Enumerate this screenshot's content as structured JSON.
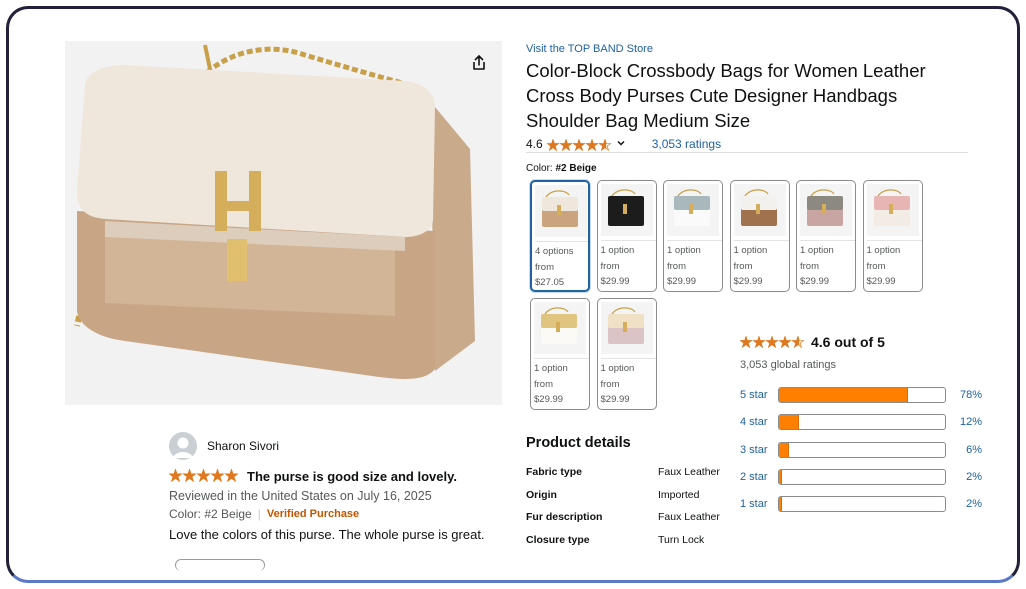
{
  "store": {
    "link_text": "Visit the TOP BAND Store"
  },
  "product": {
    "title": "Color-Block Crossbody Bags for Women Leather Cross Body Purses Cute Designer Handbags Shoulder Bag Medium Size",
    "rating_value": "4.6",
    "rating_stars": 4.6,
    "ratings_link": "3,053 ratings"
  },
  "color": {
    "label": "Color:",
    "selected": "#2 Beige",
    "options": [
      {
        "line1": "4 options",
        "line2": "from",
        "price": "$27.05",
        "top": "#efe7dc",
        "body": "#c9a47e"
      },
      {
        "line1": "1 option",
        "line2": "from",
        "price": "$29.99",
        "top": "#1c1c1c",
        "body": "#1c1c1c"
      },
      {
        "line1": "1 option",
        "line2": "from",
        "price": "$29.99",
        "top": "#a9b8bd",
        "body": "#fafafa"
      },
      {
        "line1": "1 option",
        "line2": "from",
        "price": "$29.99",
        "top": "#f3f1ee",
        "body": "#a0734e"
      },
      {
        "line1": "1 option",
        "line2": "from",
        "price": "$29.99",
        "top": "#8c8a80",
        "body": "#c8a5a2"
      },
      {
        "line1": "1 option",
        "line2": "from",
        "price": "$29.99",
        "top": "#e7b5b3",
        "body": "#f3ece6"
      },
      {
        "line1": "1 option",
        "line2": "from",
        "price": "$29.99",
        "top": "#e0c581",
        "body": "#fbfaf6"
      },
      {
        "line1": "1 option",
        "line2": "from",
        "price": "$29.99",
        "top": "#efe0c6",
        "body": "#dcc3c6"
      }
    ]
  },
  "summary": {
    "out_of": "4.6 out of 5",
    "global": "3,053 global ratings",
    "histogram": [
      {
        "label": "5 star",
        "percent": 78,
        "pct_text": "78%"
      },
      {
        "label": "4 star",
        "percent": 12,
        "pct_text": "12%"
      },
      {
        "label": "3 star",
        "percent": 6,
        "pct_text": "6%"
      },
      {
        "label": "2 star",
        "percent": 2,
        "pct_text": "2%"
      },
      {
        "label": "1 star",
        "percent": 2,
        "pct_text": "2%"
      }
    ]
  },
  "details": {
    "heading": "Product details",
    "rows": [
      {
        "key": "Fabric type",
        "value": "Faux Leather"
      },
      {
        "key": "Origin",
        "value": "Imported"
      },
      {
        "key": "Fur description",
        "value": "Faux Leather"
      },
      {
        "key": "Closure type",
        "value": "Turn Lock"
      }
    ]
  },
  "review": {
    "name": "Sharon Sivori",
    "stars": 5,
    "title": "The purse is good size and lovely.",
    "meta": "Reviewed in the United States on July 16, 2025",
    "color": "Color: #2 Beige",
    "verified": "Verified Purchase",
    "body": "Love the colors of this purse. The whole purse is great."
  },
  "colors": {
    "star": "#de7921",
    "link": "#2162a1",
    "bar_fill": "#ff7f00",
    "verified": "#c45500"
  }
}
